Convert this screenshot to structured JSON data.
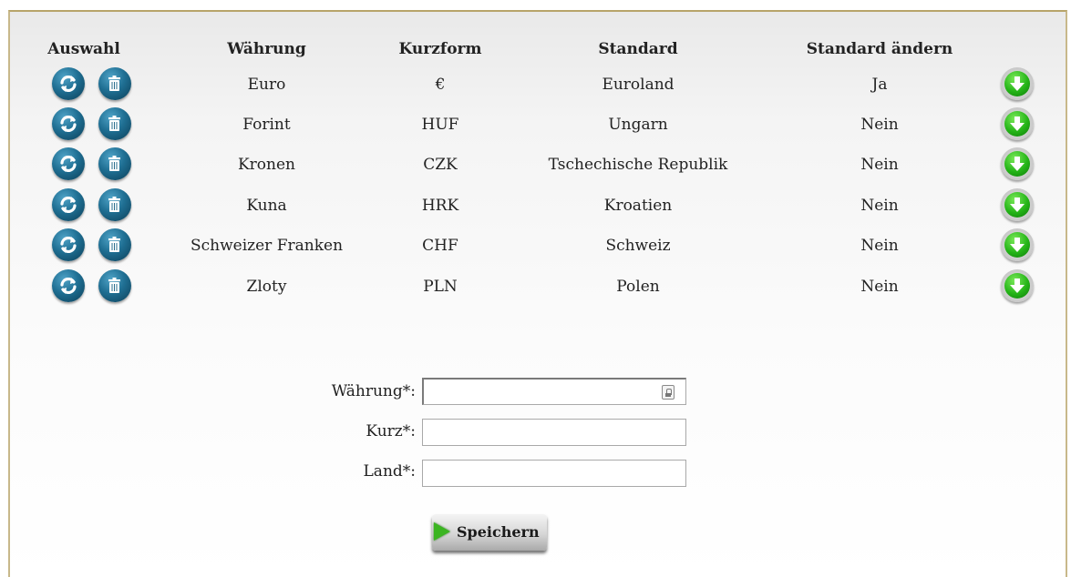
{
  "table": {
    "headers": {
      "auswahl": "Auswahl",
      "waehrung": "Währung",
      "kurzform": "Kurzform",
      "standard": "Standard",
      "standard_aendern": "Standard ändern"
    },
    "rows": [
      {
        "waehrung": "Euro",
        "kurzform": "€",
        "standard": "Euroland",
        "standard_aendern": "Ja"
      },
      {
        "waehrung": "Forint",
        "kurzform": "HUF",
        "standard": "Ungarn",
        "standard_aendern": "Nein"
      },
      {
        "waehrung": "Kronen",
        "kurzform": "CZK",
        "standard": "Tschechische Republik",
        "standard_aendern": "Nein"
      },
      {
        "waehrung": "Kuna",
        "kurzform": "HRK",
        "standard": "Kroatien",
        "standard_aendern": "Nein"
      },
      {
        "waehrung": "Schweizer Franken",
        "kurzform": "CHF",
        "standard": "Schweiz",
        "standard_aendern": "Nein"
      },
      {
        "waehrung": "Zloty",
        "kurzform": "PLN",
        "standard": "Polen",
        "standard_aendern": "Nein"
      }
    ],
    "row_icons": {
      "refresh": "refresh-icon",
      "delete": "trash-icon",
      "set_default": "arrow-down-icon"
    }
  },
  "form": {
    "waehrung_label": "Währung*:",
    "kurz_label": "Kurz*:",
    "land_label": "Land*:",
    "waehrung_value": "",
    "kurz_value": "",
    "land_value": "",
    "save_label": "Speichern"
  },
  "colors": {
    "frame_border": "#b7a46a",
    "action_icon_blue": "#1f6f93",
    "default_green": "#24b417"
  }
}
